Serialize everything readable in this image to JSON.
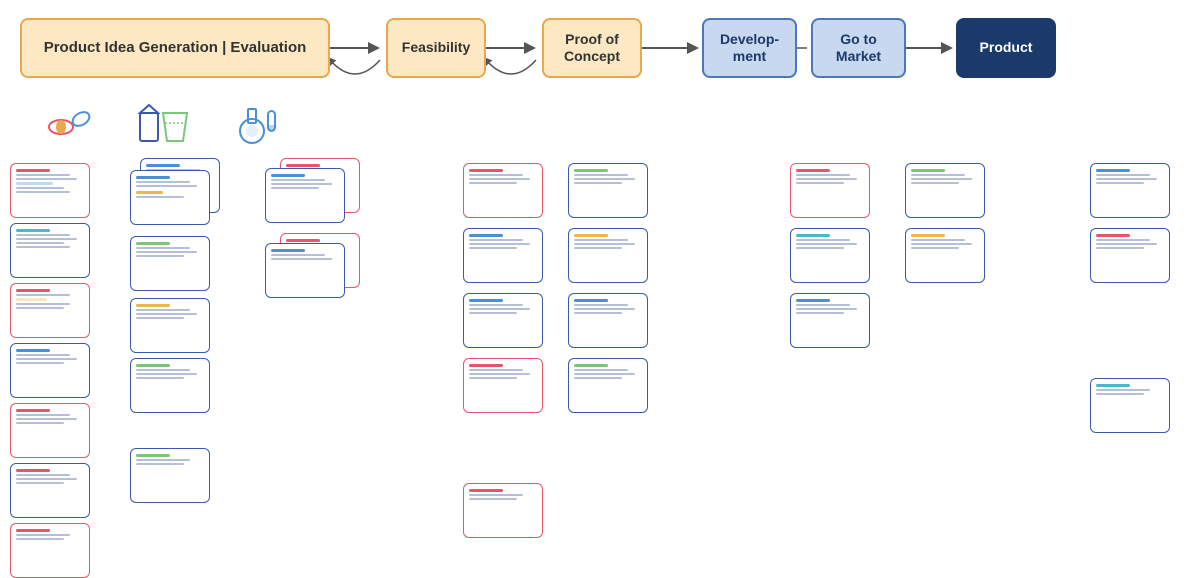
{
  "pipeline": {
    "stages": [
      {
        "id": "idea",
        "label": "Product Idea Generation | Evaluation",
        "type": "idea"
      },
      {
        "id": "feasibility",
        "label": "Feasibility",
        "type": "feasibility"
      },
      {
        "id": "poc",
        "label": "Proof of Concept",
        "type": "poc"
      },
      {
        "id": "dev",
        "label": "Develop-ment",
        "type": "dev"
      },
      {
        "id": "gtm",
        "label": "Go to Market",
        "type": "gtm"
      },
      {
        "id": "product",
        "label": "Product",
        "type": "product"
      }
    ]
  },
  "icons": [
    "💊",
    "🥛",
    "⚗️"
  ],
  "colors": {
    "idea_bg": "#fce8c3",
    "idea_border": "#e8a84e",
    "dev_bg": "#c7d8f0",
    "dev_border": "#4a7ab5",
    "product_bg": "#1a3a6b"
  }
}
